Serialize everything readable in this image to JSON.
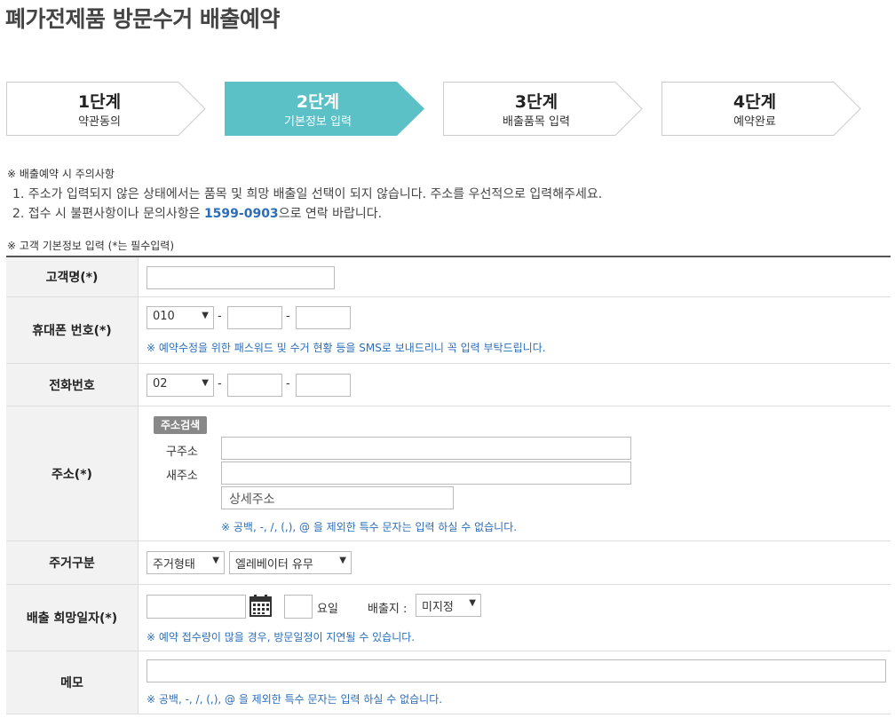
{
  "page": {
    "title": "폐가전제품 방문수거 배출예약"
  },
  "steps": [
    {
      "num": "1단계",
      "label": "약관동의"
    },
    {
      "num": "2단계",
      "label": "기본정보 입력"
    },
    {
      "num": "3단계",
      "label": "배출품목 입력"
    },
    {
      "num": "4단계",
      "label": "예약완료"
    }
  ],
  "notice": {
    "heading": "※ 배출예약 시 주의사항",
    "line1": "1. 주소가 입력되지 않은 상태에서는 품목 및 희망 배출일 선택이 되지 않습니다. 주소를 우선적으로 입력해주세요.",
    "line2_pre": "2. 접수 시 불편사항이나 문의사항은 ",
    "line2_phone": "1599-0903",
    "line2_post": "으로 연락 바랍니다."
  },
  "form": {
    "heading": "※ 고객 기본정보 입력 (*는 필수입력)",
    "name": {
      "label": "고객명(*)",
      "value": ""
    },
    "mobile": {
      "label": "휴대폰 번호(*)",
      "prefix": "010",
      "mid": "",
      "last": "",
      "hint": "※ 예약수정을 위한 패스워드 및 수거 현황 등을 SMS로 보내드리니 꼭 입력 부탁드립니다."
    },
    "phone": {
      "label": "전화번호",
      "prefix": "02",
      "mid": "",
      "last": ""
    },
    "address": {
      "label": "주소(*)",
      "search_button": "주소검색",
      "old_label": "구주소",
      "new_label": "새주소",
      "old_value": "",
      "new_value": "",
      "detail_placeholder": "상세주소",
      "hint": "※ 공백, -, /, (,), @ 을 제외한 특수 문자는 입력 하실 수 없습니다."
    },
    "housing": {
      "label": "주거구분",
      "type_select": "주거형태",
      "elevator_select": "엘레베이터 유무"
    },
    "date": {
      "label": "배출 희망일자(*)",
      "value": "",
      "weekday": "",
      "weekday_suffix": "요일",
      "location_label": "배출지 :",
      "location_select": "미지정",
      "hint": "※ 예약 접수량이 많을 경우, 방문일정이 지연될 수 있습니다."
    },
    "memo": {
      "label": "메모",
      "value": "",
      "hint": "※ 공백, -, /, (,), @ 을 제외한 특수 문자는 입력 하실 수 없습니다."
    }
  },
  "colors": {
    "active_step": "#5cc1c7",
    "link_blue": "#2a6ebb"
  }
}
